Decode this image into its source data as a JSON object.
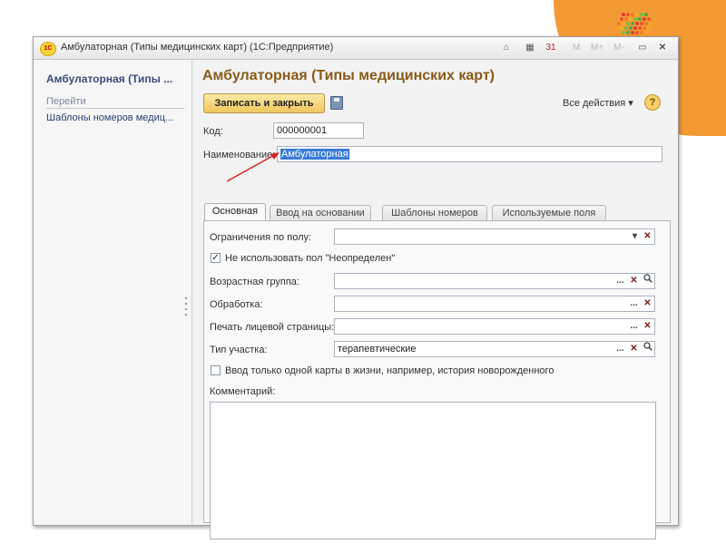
{
  "window": {
    "title": "Амбулаторная (Типы медицинских карт)  (1С:Предприятие)",
    "logo": "1С",
    "toolbar_m": "M",
    "toolbar_mplus": "M+",
    "toolbar_mminus": "M-"
  },
  "sidebar": {
    "title": "Амбулаторная (Типы ...",
    "section": "Перейти",
    "link": "Шаблоны номеров медиц..."
  },
  "form": {
    "title": "Амбулаторная (Типы медицинских карт)",
    "save_close_label": "Записать и закрыть",
    "all_actions_label": "Все действия ▾",
    "help_label": "?",
    "code_label": "Код:",
    "code_value": "000000001",
    "name_label": "Наименование:",
    "name_value": "Амбулаторная"
  },
  "tabs": [
    {
      "label": "Основная"
    },
    {
      "label": "Ввод на основании"
    },
    {
      "label": "Шаблоны номеров"
    },
    {
      "label": "Используемые поля"
    }
  ],
  "main_tab": {
    "gender_label": "Ограничения по полу:",
    "gender_value": "",
    "no_undefined_label": "Не использовать пол \"Неопределен\"",
    "no_undefined_checked": true,
    "age_group_label": "Возрастная группа:",
    "age_group_value": "",
    "processing_label": "Обработка:",
    "processing_value": "",
    "print_label": "Печать лицевой страницы:",
    "print_value": "",
    "area_type_label": "Тип участка:",
    "area_type_value": "терапевтические",
    "single_card_label": "Ввод только одной карты в жизни, например, история новорожденного",
    "single_card_checked": false,
    "comment_label": "Комментарий:",
    "comment_value": ""
  },
  "controls": {
    "dots": "...",
    "clear": "✕",
    "search": "🔍",
    "dropdown": "▾",
    "check": "✓"
  },
  "colors": {
    "accent_title": "#8a5a18",
    "save_button": "#efc75e",
    "background_orange": "#f39a35",
    "selection": "#3a7bd5"
  }
}
